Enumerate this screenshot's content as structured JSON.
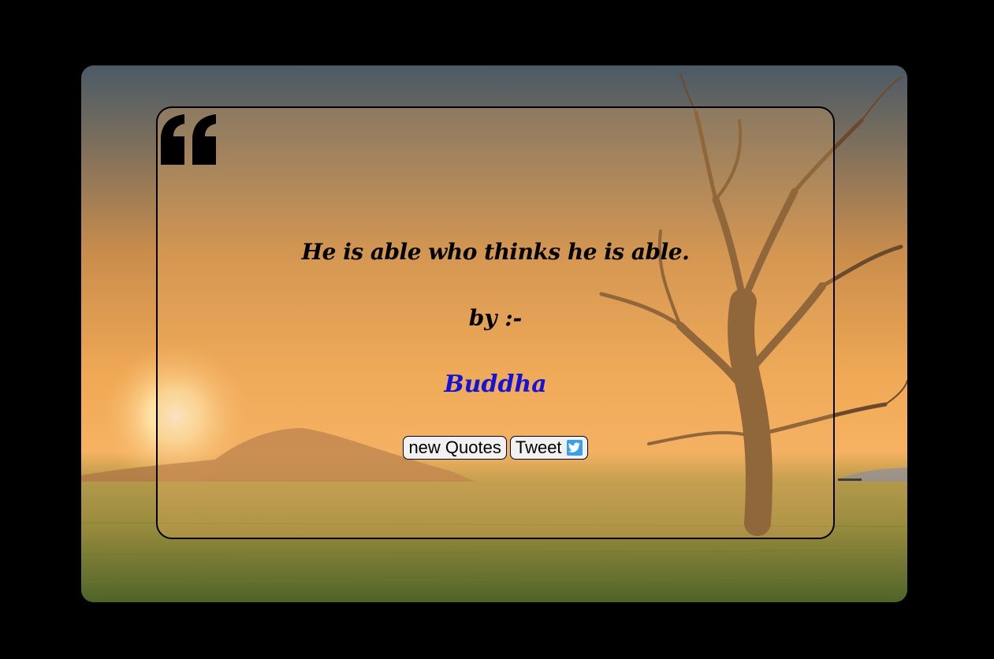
{
  "quote": {
    "text": "He is able who thinks he is able.",
    "by_label": "by :-",
    "author": "Buddha"
  },
  "buttons": {
    "new_quote_label": "new Quotes",
    "tweet_label": "Tweet"
  },
  "icons": {
    "quote_mark": "left-double-quote-icon",
    "twitter": "twitter-icon"
  },
  "colors": {
    "page_background": "#000000",
    "author_text": "#1414d8",
    "quote_text": "#000000",
    "twitter_blue": "#3aa1e8",
    "button_background": "#f1f1f1"
  }
}
